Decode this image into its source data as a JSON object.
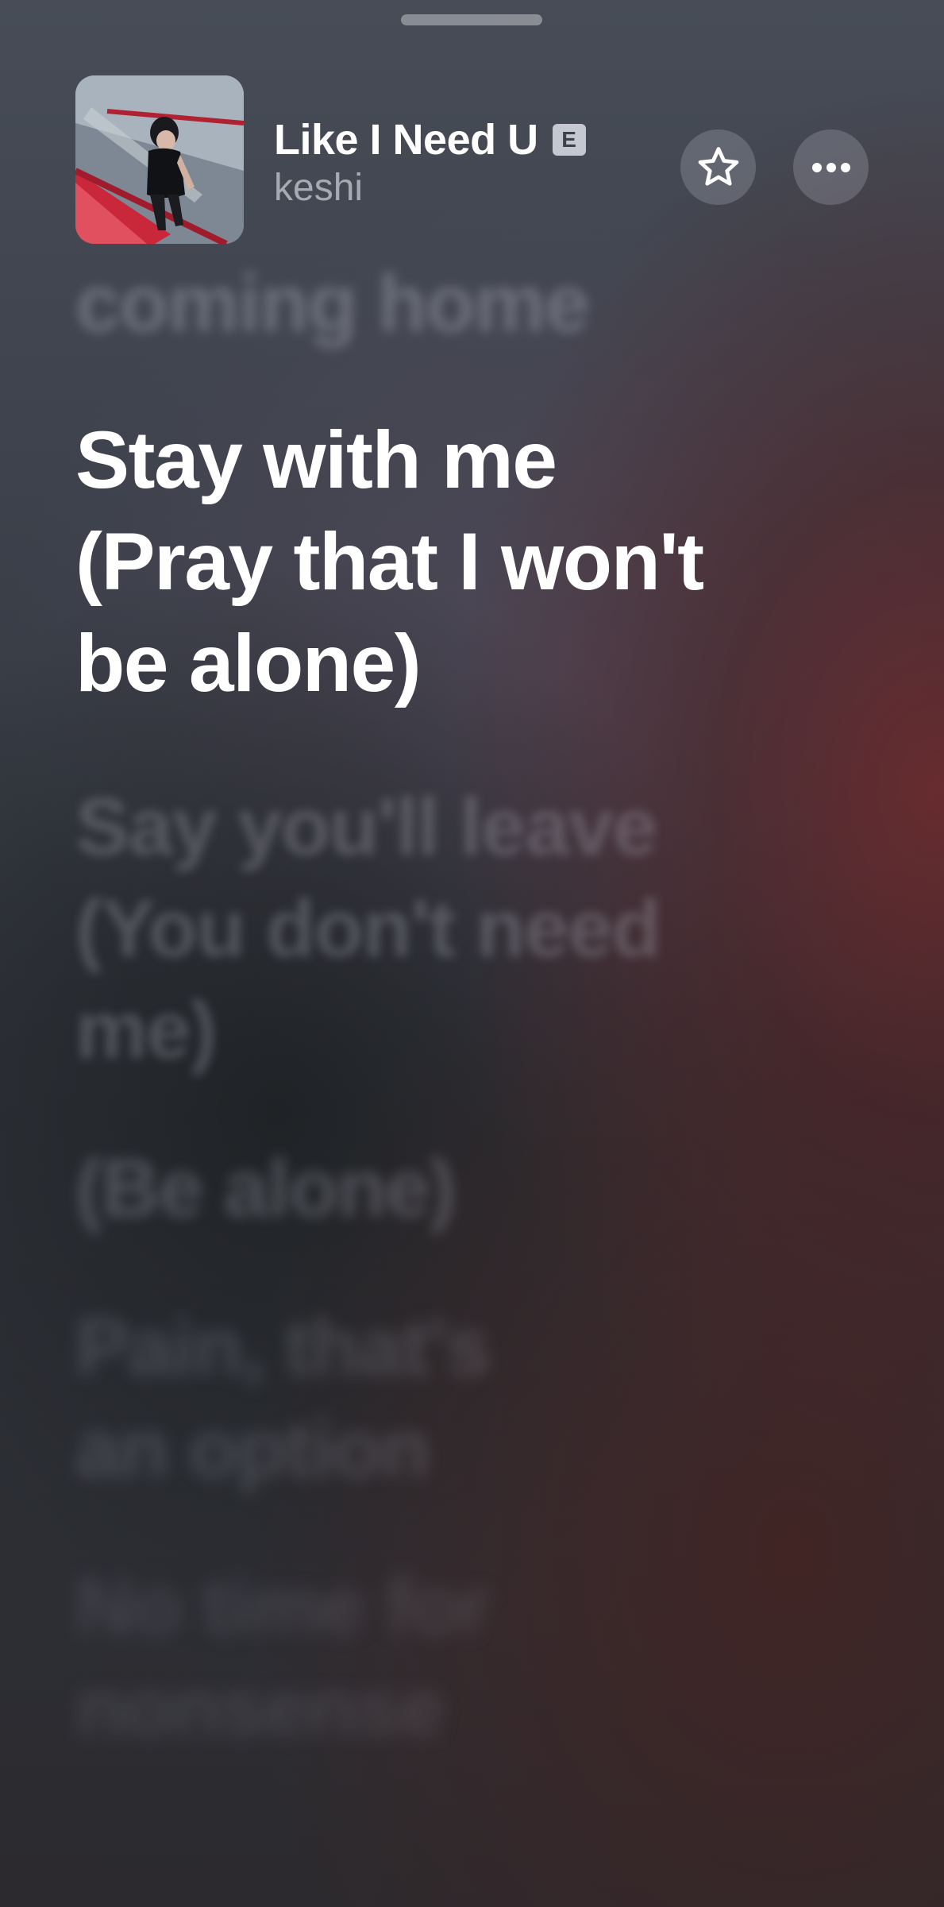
{
  "now_playing": {
    "title": "Like I Need U",
    "explicit_badge": "E",
    "artist": "keshi"
  },
  "controls": {
    "favorite_icon": "star-icon",
    "more_icon": "ellipsis-icon"
  },
  "lyrics": {
    "past_line": "coming home",
    "current_line": [
      "Stay with me",
      "(Pray that I won't",
      "be alone)"
    ],
    "upcoming": [
      [
        "Say you'll leave",
        "(You don't need",
        "me)"
      ],
      [
        "(Be alone)"
      ],
      [
        "Pain, that's",
        "an option"
      ],
      [
        "No time for",
        "nonsense"
      ]
    ]
  },
  "colors": {
    "current_lyric": "#ffffff",
    "background_top": "#474c57",
    "background_accent": "#6e282a"
  }
}
